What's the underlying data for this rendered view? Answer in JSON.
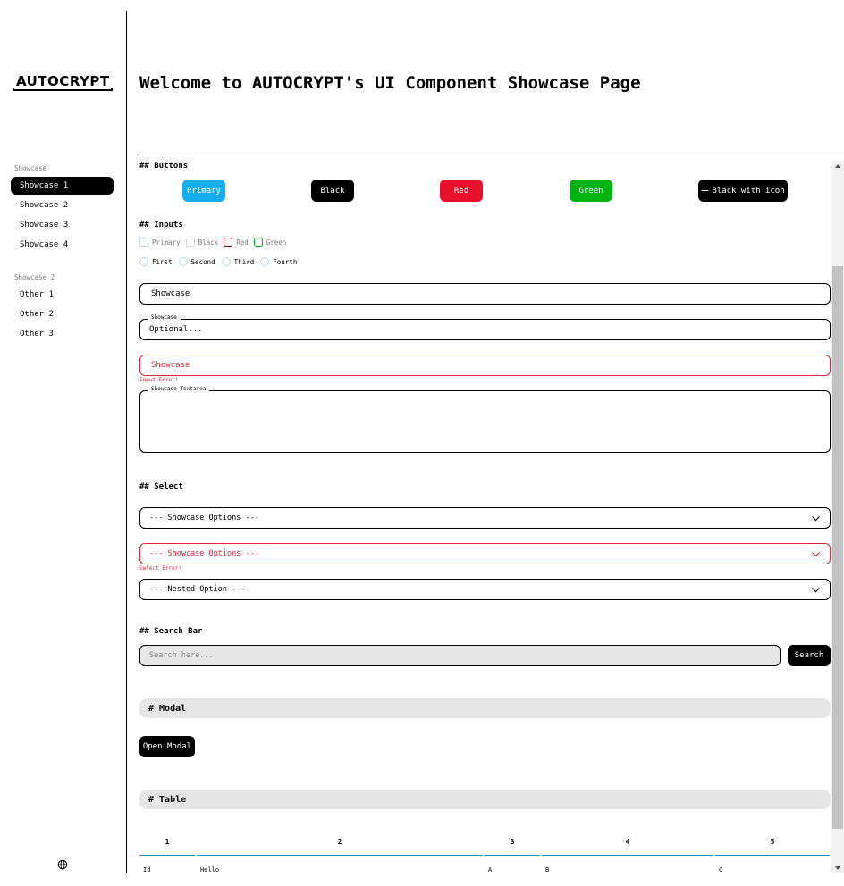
{
  "brand": {
    "logo_text": "AUTOCRYPT"
  },
  "sidebar": {
    "groups": [
      {
        "title": "Showcase",
        "items": [
          "Showcase 1",
          "Showcase 2",
          "Showcase 3",
          "Showcase 4"
        ],
        "active_index": 0
      },
      {
        "title": "Showcase 2",
        "items": [
          "Other 1",
          "Other 2",
          "Other 3"
        ]
      }
    ],
    "footer_icon": "globe-icon"
  },
  "header": {
    "title": "Welcome to AUTOCRYPT's UI Component Showcase Page"
  },
  "sections": {
    "buttons": {
      "title": "## Buttons",
      "items": [
        {
          "label": "Primary",
          "color": "#14aeef"
        },
        {
          "label": "Black",
          "color": "#000000"
        },
        {
          "label": "Red",
          "color": "#e8102d"
        },
        {
          "label": "Green",
          "color": "#00b212"
        },
        {
          "label": "Black with icon",
          "color": "#000000",
          "icon": "plus-icon"
        }
      ]
    },
    "inputs": {
      "title": "## Inputs",
      "checkboxes": [
        {
          "label": "Primary",
          "color": "#b8d6ea"
        },
        {
          "label": "Black",
          "color": "#d8d8d8"
        },
        {
          "label": "Red",
          "color": "#8b0020"
        },
        {
          "label": "Green",
          "color": "#00a020"
        }
      ],
      "radios": [
        "First",
        "Second",
        "Third",
        "Fourth"
      ],
      "text_field": {
        "value": "Showcase"
      },
      "labeled_field": {
        "label": "Showcase",
        "placeholder": "Optional..."
      },
      "error_field": {
        "value": "Showcase",
        "error": "Input Error!"
      },
      "textarea": {
        "label": "Showcase Textarea"
      }
    },
    "select": {
      "title": "## Select",
      "default": {
        "value": "--- Showcase Options ---"
      },
      "error": {
        "value": "--- Showcase Options ---",
        "message": "Select Error!"
      },
      "nested": {
        "value": "--- Nested Option ---"
      }
    },
    "search": {
      "title": "## Search Bar",
      "placeholder": "Search here...",
      "button": "Search"
    },
    "modal": {
      "title": "# Modal",
      "button": "Open Modal"
    },
    "table": {
      "title": "# Table",
      "headers": [
        "1",
        "2",
        "3",
        "4",
        "5"
      ],
      "rows": [
        [
          "Id",
          "Hello",
          "A",
          "B",
          "C"
        ]
      ],
      "accent": "#1a93d6"
    }
  },
  "colors": {
    "error": "#e0233d",
    "muted_bg": "#e6e6e6"
  }
}
